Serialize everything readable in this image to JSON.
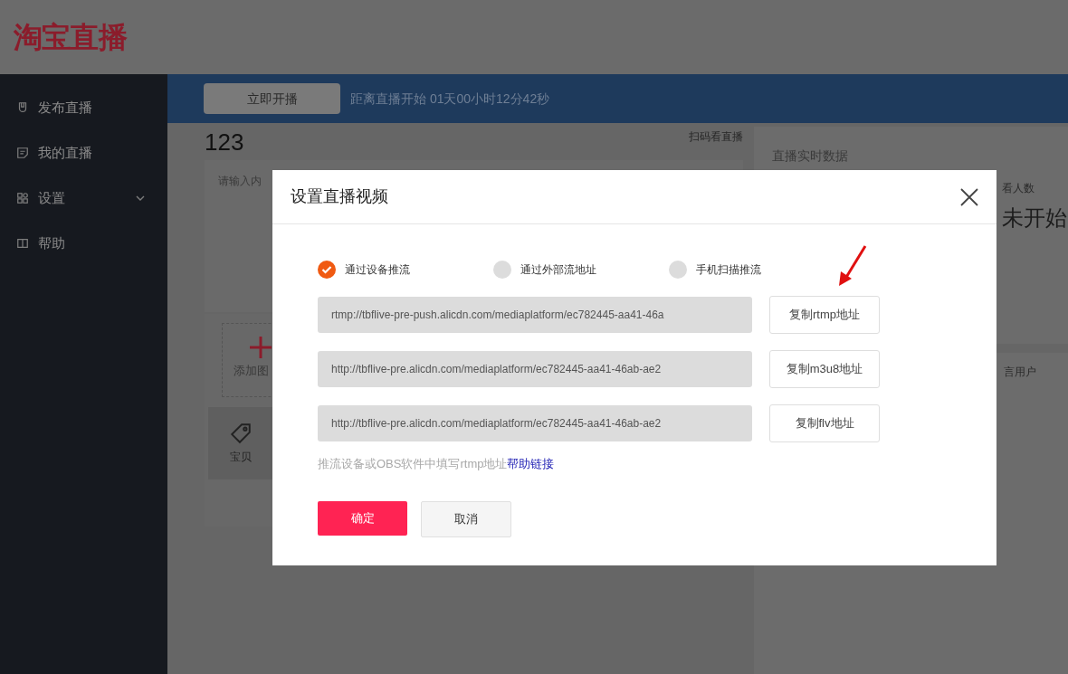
{
  "logo": "淘宝直播",
  "sidebar": {
    "items": [
      {
        "label": "发布直播",
        "expandable": false
      },
      {
        "label": "我的直播",
        "expandable": false
      },
      {
        "label": "设置",
        "expandable": true
      },
      {
        "label": "帮助",
        "expandable": false
      }
    ]
  },
  "top_bar": {
    "start_button": "立即开播",
    "countdown": "距离直播开始 01天00小时12分42秒"
  },
  "main": {
    "title": "123",
    "qr_link": "扫码看直播",
    "content_placeholder": "请输入内",
    "add_image": "添加图",
    "tab": "宝贝"
  },
  "right_panel": {
    "title": "直播实时数据",
    "viewers_label": "看人数",
    "status": "未开始",
    "muted_users": "言用户"
  },
  "dialog": {
    "title": "设置直播视频",
    "options": [
      {
        "label": "通过设备推流",
        "selected": true
      },
      {
        "label": "通过外部流地址",
        "selected": false
      },
      {
        "label": "手机扫描推流",
        "selected": false
      }
    ],
    "urls": [
      {
        "value": "rtmp://tbflive-pre-push.alicdn.com/mediaplatform/ec782445-aa41-46a",
        "button": "复制rtmp地址"
      },
      {
        "value": "http://tbflive-pre.alicdn.com/mediaplatform/ec782445-aa41-46ab-ae2",
        "button": "复制m3u8地址"
      },
      {
        "value": "http://tbflive-pre.alicdn.com/mediaplatform/ec782445-aa41-46ab-ae2",
        "button": "复制flv地址"
      }
    ],
    "hint": "推流设备或OBS软件中填写rtmp地址",
    "help_link": "帮助链接",
    "confirm": "确定",
    "cancel": "取消"
  }
}
